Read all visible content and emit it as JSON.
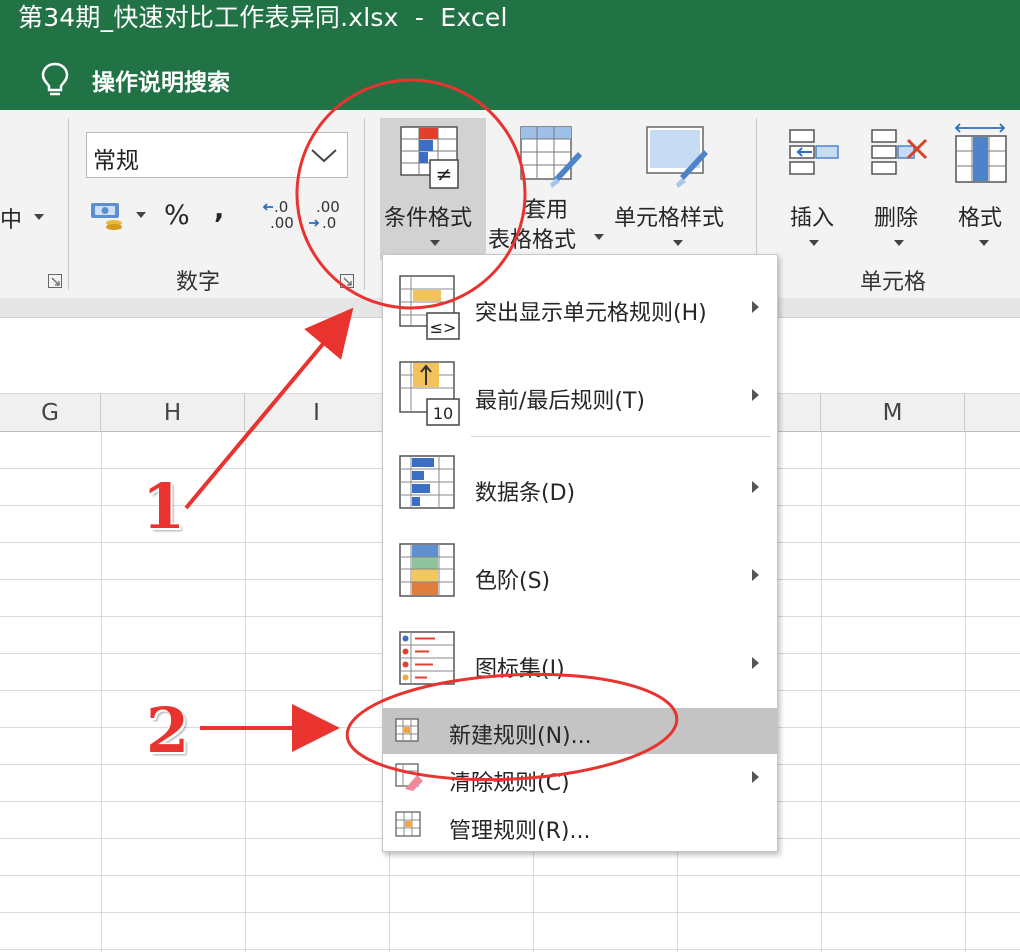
{
  "window": {
    "title": "第34期_快速对比工作表异同.xlsx  -  Excel",
    "tellme": "操作说明搜索"
  },
  "ribbon": {
    "partial_button_char": "中",
    "number_format_value": "常规",
    "percent": "%",
    "comma": ",",
    "inc_decimal_top": ".0",
    "inc_decimal_bottom": ".00",
    "dec_decimal_top": ".00",
    "dec_decimal_bottom": ".0",
    "number_group_label": "数字",
    "conditional_format": "条件格式",
    "format_as_table_line1": "套用",
    "format_as_table_line2": "表格格式",
    "cell_styles": "单元格样式",
    "insert": "插入",
    "delete": "删除",
    "format": "格式",
    "cells_group_label": "单元格"
  },
  "columns": [
    "G",
    "H",
    "I",
    "M"
  ],
  "menu": {
    "items": [
      {
        "label": "突出显示单元格规则(H)",
        "icon": "highlight-cells-rules-icon",
        "submenu": true
      },
      {
        "label": "最前/最后规则(T)",
        "icon": "top-bottom-rules-icon",
        "submenu": true,
        "badge": "10"
      },
      {
        "label": "数据条(D)",
        "icon": "data-bars-icon",
        "submenu": true
      },
      {
        "label": "色阶(S)",
        "icon": "color-scales-icon",
        "submenu": true
      },
      {
        "label": "图标集(I)",
        "icon": "icon-sets-icon",
        "submenu": true
      },
      {
        "label": "新建规则(N)...",
        "icon": "new-rule-icon",
        "submenu": false,
        "highlighted": true
      },
      {
        "label": "清除规则(C)",
        "icon": "clear-rules-icon",
        "submenu": true
      },
      {
        "label": "管理规则(R)...",
        "icon": "manage-rules-icon",
        "submenu": false
      }
    ]
  },
  "annotations": {
    "step1": "1",
    "step2": "2",
    "color": "#e8332f"
  },
  "colors": {
    "excel_green": "#217346",
    "ribbon_bg": "#f3f3f3",
    "menu_highlight": "#c4c4c4"
  }
}
